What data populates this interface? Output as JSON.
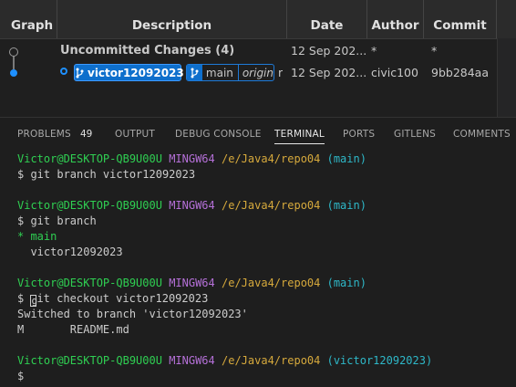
{
  "graph": {
    "columns": [
      "Graph",
      "Description",
      "Date",
      "Author",
      "Commit"
    ],
    "uncommitted": {
      "label": "Uncommitted Changes (4)",
      "date": "12 Sep 202...",
      "author": "*",
      "commit": "*"
    },
    "commit_row": {
      "branch_tag": "victor12092023",
      "main_tag": "main",
      "remote_tag": "origin",
      "trunc": "r",
      "date": "12 Sep 202...",
      "author": "civic100",
      "commit": "9bb284aa"
    }
  },
  "tabs": {
    "items": [
      "PROBLEMS",
      "OUTPUT",
      "DEBUG CONSOLE",
      "TERMINAL",
      "PORTS",
      "GITLENS",
      "COMMENTS"
    ],
    "problems_count": "49",
    "active": "TERMINAL"
  },
  "terminal": {
    "prompt_user": "Victor@DESKTOP-QB9U00U",
    "prompt_env": "MINGW64",
    "prompt_path": "/e/Java4/repo04",
    "branch_main": "(main)",
    "branch_victor": "(victor12092023)",
    "cmd1": "$ git branch victor12092023",
    "cmd2": "$ git branch",
    "out_main": "* main",
    "out_victor": "  victor12092023",
    "cmd3_pre": "$ ",
    "cmd3_cursor_char": "g",
    "cmd3_post": "it checkout victor12092023",
    "out_switched": "Switched to branch 'victor12092023'",
    "out_modified": "M       README.md",
    "final_prompt": "$"
  }
}
